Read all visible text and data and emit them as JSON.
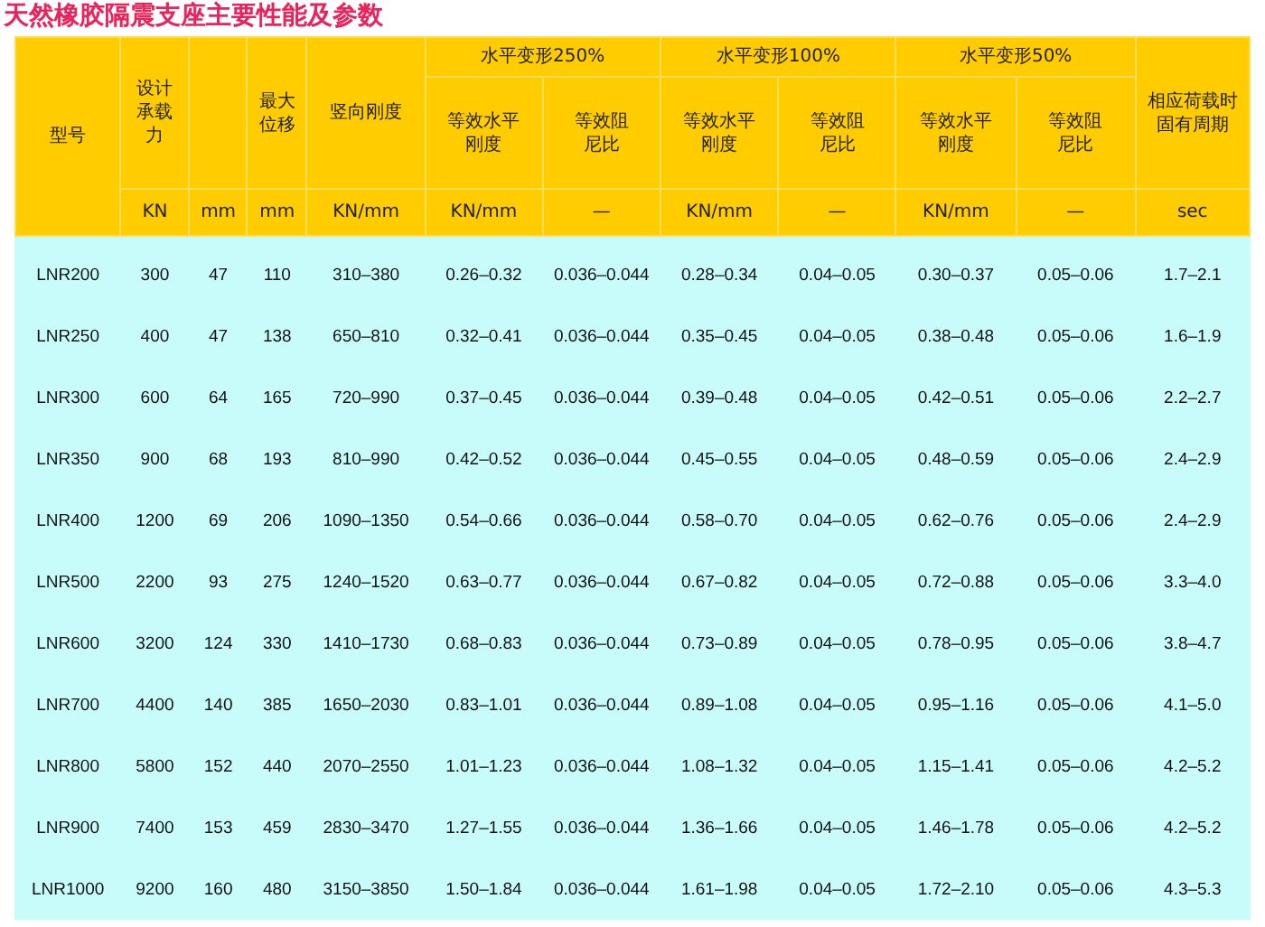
{
  "title": "天然橡胶隔震支座主要性能及参数",
  "table": {
    "columns": [
      {
        "label": "型号"
      },
      {
        "label": "设计承载力",
        "unit": "KN"
      },
      {
        "unit": "mm"
      },
      {
        "label": "最大位移",
        "unit": "mm"
      },
      {
        "label": "竖向刚度",
        "unit": "KN/mm"
      },
      {
        "label": "等效水平刚度",
        "unit": "KN/mm"
      },
      {
        "label": "等效阻尼比",
        "unit": "—"
      },
      {
        "label": "等效水平刚度",
        "unit": "KN/mm"
      },
      {
        "label": "等效阻尼比",
        "unit": "—"
      },
      {
        "label": "等效水平刚度",
        "unit": "KN/mm"
      },
      {
        "label": "等效阻尼比",
        "unit": "—"
      },
      {
        "label": "相应荷载时固有周期",
        "unit": "sec"
      }
    ],
    "column_groups": [
      {
        "label": "水平变形250%"
      },
      {
        "label": "水平变形100%"
      },
      {
        "label": "水平变形50%"
      }
    ],
    "rows": [
      [
        "LNR200",
        "300",
        "47",
        "110",
        "310–380",
        "0.26–0.32",
        "0.036–0.044",
        "0.28–0.34",
        "0.04–0.05",
        "0.30–0.37",
        "0.05–0.06",
        "1.7–2.1"
      ],
      [
        "LNR250",
        "400",
        "47",
        "138",
        "650–810",
        "0.32–0.41",
        "0.036–0.044",
        "0.35–0.45",
        "0.04–0.05",
        "0.38–0.48",
        "0.05–0.06",
        "1.6–1.9"
      ],
      [
        "LNR300",
        "600",
        "64",
        "165",
        "720–990",
        "0.37–0.45",
        "0.036–0.044",
        "0.39–0.48",
        "0.04–0.05",
        "0.42–0.51",
        "0.05–0.06",
        "2.2–2.7"
      ],
      [
        "LNR350",
        "900",
        "68",
        "193",
        "810–990",
        "0.42–0.52",
        "0.036–0.044",
        "0.45–0.55",
        "0.04–0.05",
        "0.48–0.59",
        "0.05–0.06",
        "2.4–2.9"
      ],
      [
        "LNR400",
        "1200",
        "69",
        "206",
        "1090–1350",
        "0.54–0.66",
        "0.036–0.044",
        "0.58–0.70",
        "0.04–0.05",
        "0.62–0.76",
        "0.05–0.06",
        "2.4–2.9"
      ],
      [
        "LNR500",
        "2200",
        "93",
        "275",
        "1240–1520",
        "0.63–0.77",
        "0.036–0.044",
        "0.67–0.82",
        "0.04–0.05",
        "0.72–0.88",
        "0.05–0.06",
        "3.3–4.0"
      ],
      [
        "LNR600",
        "3200",
        "124",
        "330",
        "1410–1730",
        "0.68–0.83",
        "0.036–0.044",
        "0.73–0.89",
        "0.04–0.05",
        "0.78–0.95",
        "0.05–0.06",
        "3.8–4.7"
      ],
      [
        "LNR700",
        "4400",
        "140",
        "385",
        "1650–2030",
        "0.83–1.01",
        "0.036–0.044",
        "0.89–1.08",
        "0.04–0.05",
        "0.95–1.16",
        "0.05–0.06",
        "4.1–5.0"
      ],
      [
        "LNR800",
        "5800",
        "152",
        "440",
        "2070–2550",
        "1.01–1.23",
        "0.036–0.044",
        "1.08–1.32",
        "0.04–0.05",
        "1.15–1.41",
        "0.05–0.06",
        "4.2–5.2"
      ],
      [
        "LNR900",
        "7400",
        "153",
        "459",
        "2830–3470",
        "1.27–1.55",
        "0.036–0.044",
        "1.36–1.66",
        "0.04–0.05",
        "1.46–1.78",
        "0.05–0.06",
        "4.2–5.2"
      ],
      [
        "LNR1000",
        "9200",
        "160",
        "480",
        "3150–3850",
        "1.50–1.84",
        "0.036–0.044",
        "1.61–1.98",
        "0.04–0.05",
        "1.72–2.10",
        "0.05–0.06",
        "4.3–5.3"
      ]
    ]
  }
}
